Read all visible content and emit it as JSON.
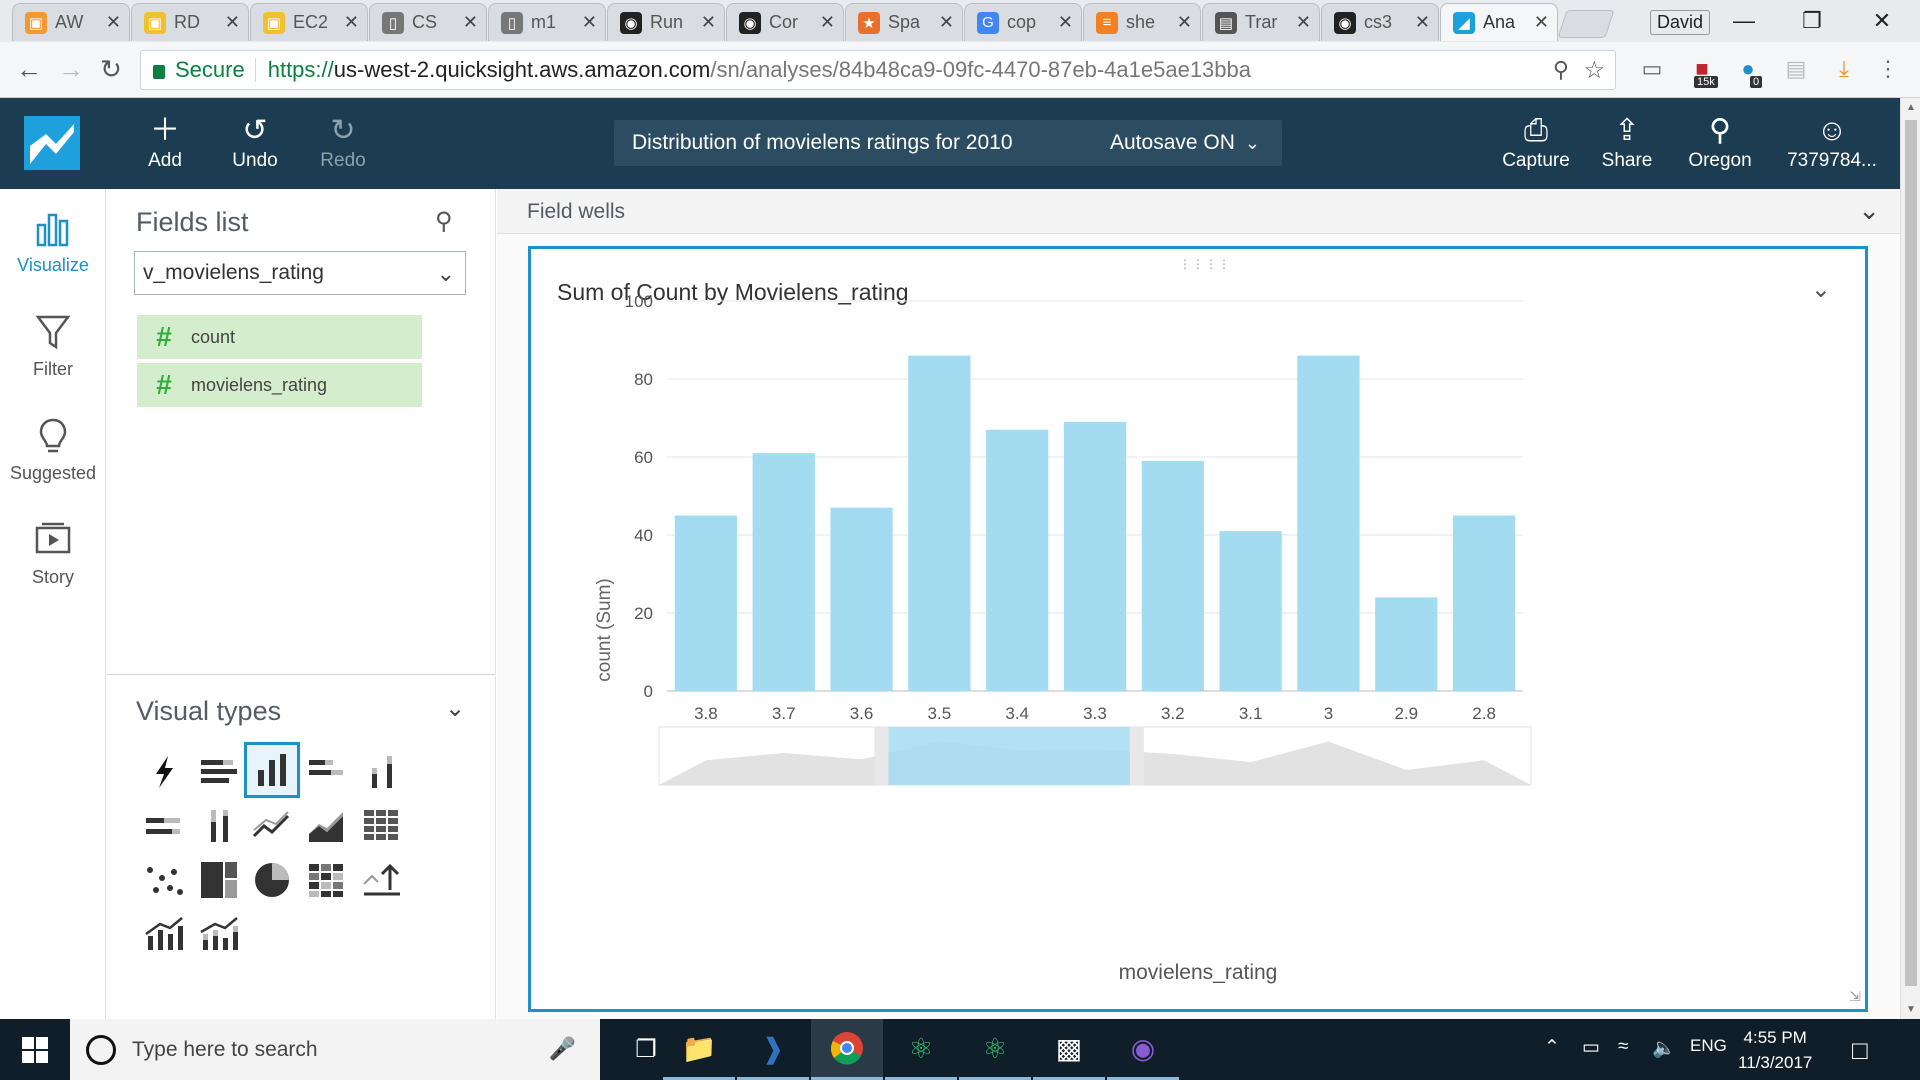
{
  "browser": {
    "tabs": [
      {
        "title": "AW",
        "icon": "aws-box-icon",
        "color": "#f29a2e"
      },
      {
        "title": "RD",
        "icon": "aws-box-icon",
        "color": "#f2c12e"
      },
      {
        "title": "EC2",
        "icon": "aws-box-icon",
        "color": "#f2c12e"
      },
      {
        "title": "CS",
        "icon": "page-icon",
        "color": "#777777"
      },
      {
        "title": "m1",
        "icon": "page-icon",
        "color": "#777777"
      },
      {
        "title": "Run",
        "icon": "github-icon",
        "color": "#222222"
      },
      {
        "title": "Cor",
        "icon": "github-icon",
        "color": "#222222"
      },
      {
        "title": "Spa",
        "icon": "star-icon",
        "color": "#e8702a"
      },
      {
        "title": "cop",
        "icon": "google-icon",
        "color": "#4285f4"
      },
      {
        "title": "she",
        "icon": "stackoverflow-icon",
        "color": "#f48024"
      },
      {
        "title": "Trar",
        "icon": "doc-icon",
        "color": "#555555"
      },
      {
        "title": "cs3",
        "icon": "github-icon",
        "color": "#222222"
      },
      {
        "title": "Ana",
        "icon": "quicksight-icon",
        "color": "#1ea0dd"
      }
    ],
    "profile": "David",
    "secure_label": "Secure",
    "url_scheme": "https://",
    "url_host": "us-west-2.quicksight.aws.amazon.com",
    "url_path": "/sn/analyses/84b48ca9-09fc-4470-87eb-4a1e5ae13bba",
    "ext_badge_1": "15k",
    "ext_badge_2": "0"
  },
  "header": {
    "add_label": "Add",
    "undo_label": "Undo",
    "redo_label": "Redo",
    "analysis_title": "Distribution of movielens ratings for 2010",
    "autosave_label": "Autosave ON",
    "capture_label": "Capture",
    "share_label": "Share",
    "region_label": "Oregon",
    "account_label": "7379784..."
  },
  "rail": {
    "visualize": "Visualize",
    "filter": "Filter",
    "suggested": "Suggested",
    "story": "Story"
  },
  "fields_panel": {
    "title": "Fields list",
    "dataset": "v_movielens_rating",
    "fields": [
      {
        "name": "count"
      },
      {
        "name": "movielens_rating"
      }
    ]
  },
  "visual_types": {
    "title": "Visual types"
  },
  "field_wells": {
    "label": "Field wells"
  },
  "visual": {
    "title": "Sum of Count by Movielens_rating"
  },
  "chart_data": {
    "type": "bar",
    "title": "Sum of Count by Movielens_rating",
    "xlabel": "movielens_rating",
    "ylabel": "count (Sum)",
    "categories": [
      "3.8",
      "3.7",
      "3.6",
      "3.5",
      "3.4",
      "3.3",
      "3.2",
      "3.1",
      "3",
      "2.9",
      "2.8"
    ],
    "values": [
      45,
      61,
      47,
      86,
      67,
      69,
      59,
      41,
      86,
      24,
      45
    ],
    "ylim": [
      0,
      100
    ],
    "yticks": [
      0,
      20,
      40,
      60,
      80,
      100
    ],
    "grid": true,
    "bar_color": "#a3dcf0",
    "mini_map_selection": [
      "3.5",
      "3.3"
    ]
  },
  "taskbar": {
    "search_placeholder": "Type here to search",
    "lang": "ENG",
    "time": "4:55 PM",
    "date": "11/3/2017"
  }
}
